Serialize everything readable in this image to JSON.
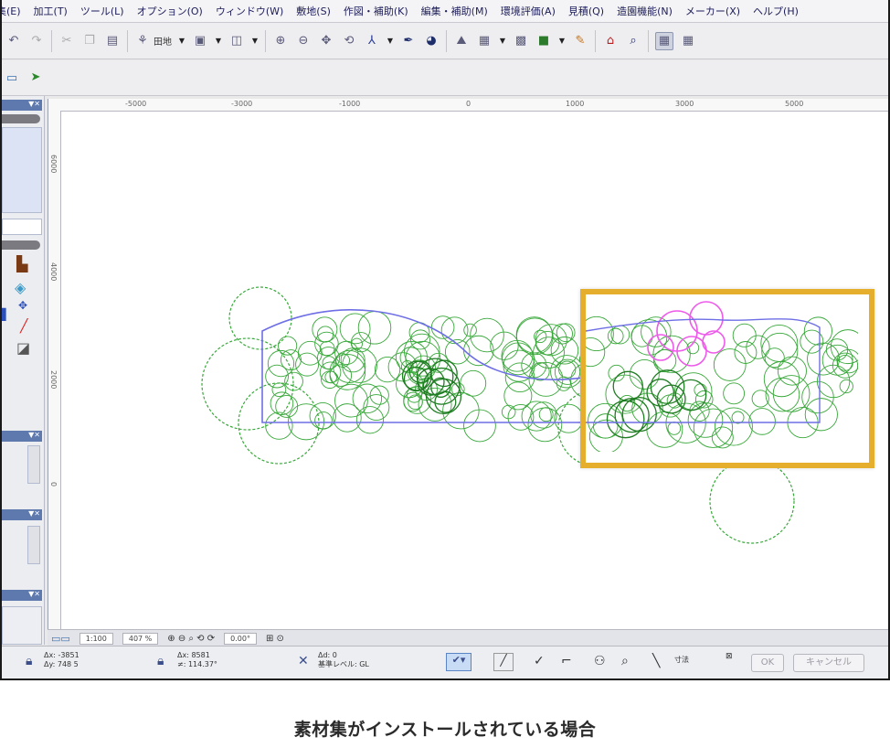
{
  "menu": {
    "items": [
      "集(E)",
      "加工(T)",
      "ツール(L)",
      "オプション(O)",
      "ウィンドウ(W)",
      "敷地(S)",
      "作図・補助(K)",
      "編集・補助(M)",
      "環境評価(A)",
      "見積(Q)",
      "造園機能(N)",
      "メーカー(X)",
      "ヘルプ(H)"
    ]
  },
  "toolbar": {
    "layout_label": "田地"
  },
  "ruler": {
    "top_labels": [
      "-5000",
      "-3000",
      "-1000",
      "0",
      "1000",
      "3000",
      "5000"
    ],
    "left_labels": [
      "6000",
      "4000",
      "2000",
      "0"
    ]
  },
  "status_bar": {
    "scale": "1:100",
    "zoom": "407 %",
    "angle": "0.00°",
    "cursor_x": "Δx: -3851",
    "cursor_y": "Δy: 748 5",
    "pos_x": "Δx: 8581",
    "pos_y": "≠: 114.37°",
    "layer_top": "Δd: 0",
    "layer_bottom": "基準レベル: GL",
    "snap_label": "寸法",
    "ok": "OK",
    "cancel": "キャンセル"
  },
  "icons": {
    "undo": "undo-icon",
    "redo": "redo-icon",
    "cut": "cut-icon",
    "copy": "copy-icon",
    "paste": "paste-icon",
    "select": "select-arrow-icon",
    "house": "house-icon",
    "search": "search-icon"
  },
  "colors": {
    "plant": "#39a83a",
    "plant_dark": "#1f7d22",
    "bed_outline": "#6e6ee6",
    "highlight_plant": "#ee5bea",
    "inset_border": "#e5ae2c",
    "dock_header": "#5d79ae"
  },
  "caption": "素材集がインストールされている場合"
}
